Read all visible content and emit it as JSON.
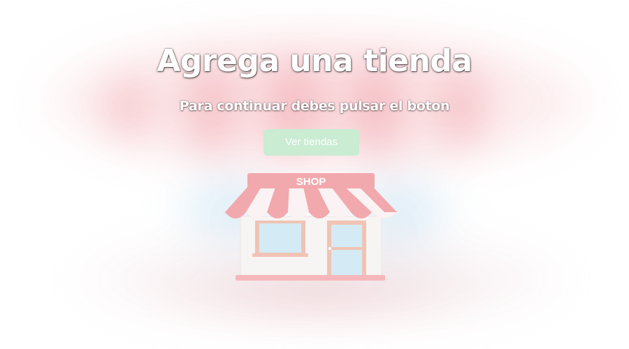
{
  "hero": {
    "title": "Agrega una tienda",
    "subtitle": "Para continuar debes pulsar el boton",
    "button_label": "Ver tiendas"
  },
  "shop_illustration": {
    "icon": "storefront-icon",
    "sign_text": "SHOP"
  },
  "colors": {
    "button_bg": "#c9ecd2",
    "awning_red": "#f2a9ad",
    "window_blue": "#d4ebf5",
    "frame_peach": "#f0c3b4"
  }
}
